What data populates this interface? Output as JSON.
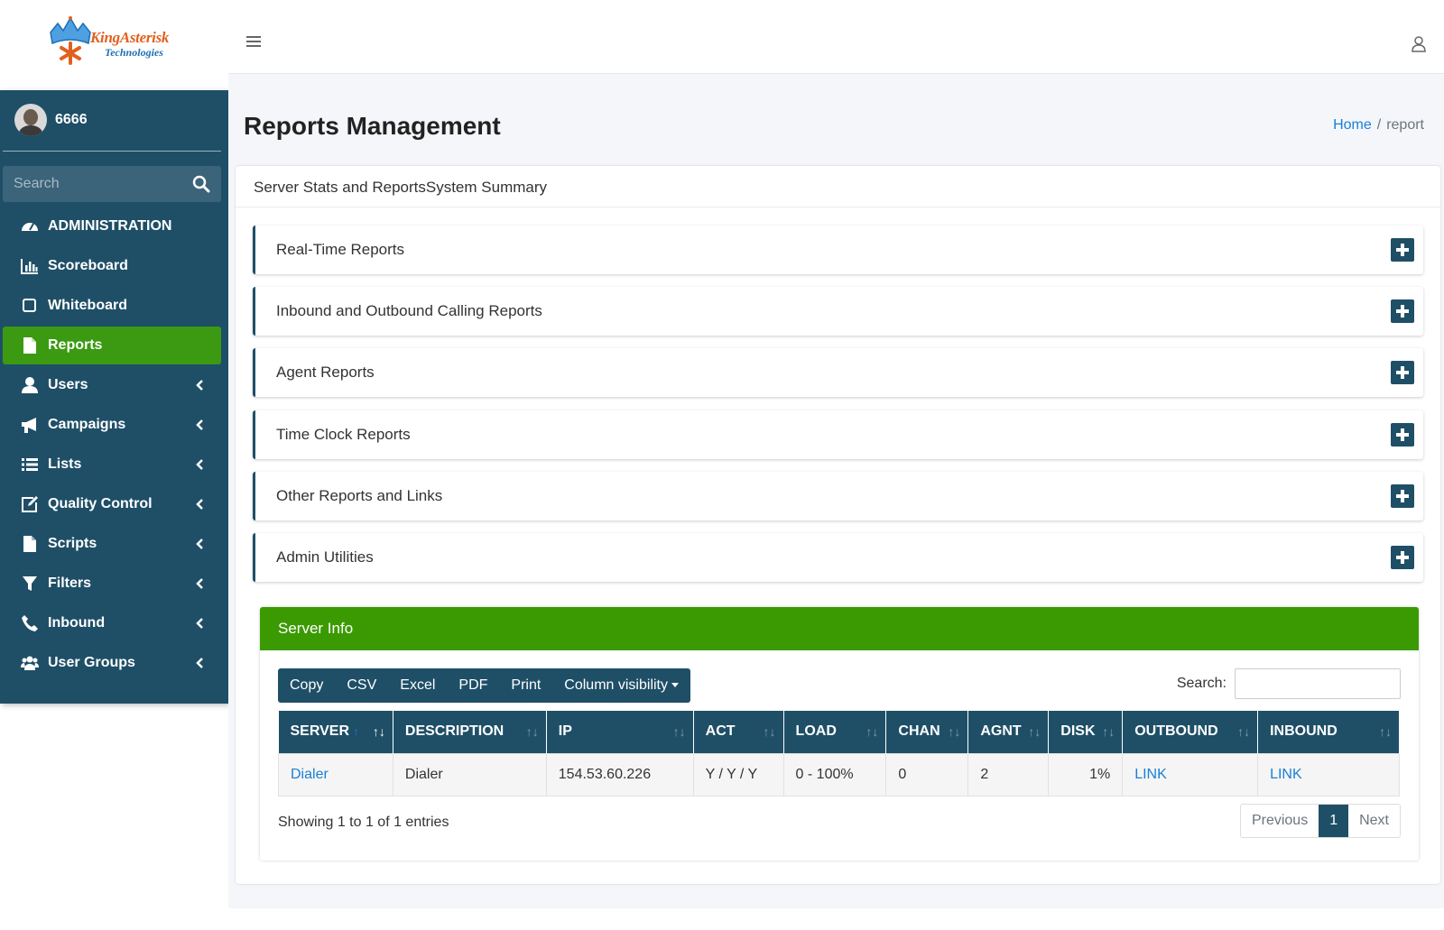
{
  "logo": {
    "brand": "KingAsterisk",
    "sub": "Technologies"
  },
  "user": {
    "name": "6666"
  },
  "sidebar": {
    "search_placeholder": "Search",
    "items": [
      {
        "label": "ADMINISTRATION",
        "icon": "dashboard-icon",
        "active": false,
        "has_chevron": false
      },
      {
        "label": "Scoreboard",
        "icon": "bar-chart-icon",
        "active": false,
        "has_chevron": false
      },
      {
        "label": "Whiteboard",
        "icon": "square-icon",
        "active": false,
        "has_chevron": false
      },
      {
        "label": "Reports",
        "icon": "file-icon",
        "active": true,
        "has_chevron": false
      },
      {
        "label": "Users",
        "icon": "user-icon",
        "active": false,
        "has_chevron": true
      },
      {
        "label": "Campaigns",
        "icon": "bullhorn-icon",
        "active": false,
        "has_chevron": true
      },
      {
        "label": "Lists",
        "icon": "list-icon",
        "active": false,
        "has_chevron": true
      },
      {
        "label": "Quality Control",
        "icon": "edit-icon",
        "active": false,
        "has_chevron": true
      },
      {
        "label": "Scripts",
        "icon": "file-icon",
        "active": false,
        "has_chevron": true
      },
      {
        "label": "Filters",
        "icon": "filter-icon",
        "active": false,
        "has_chevron": true
      },
      {
        "label": "Inbound",
        "icon": "phone-icon",
        "active": false,
        "has_chevron": true
      },
      {
        "label": "User Groups",
        "icon": "users-icon",
        "active": false,
        "has_chevron": true
      }
    ]
  },
  "page": {
    "title": "Reports Management",
    "breadcrumb": {
      "home": "Home",
      "sep": "/",
      "current": "report"
    },
    "card_title": "Server Stats and ReportsSystem Summary"
  },
  "sections": [
    "Real-Time Reports",
    "Inbound and Outbound Calling Reports",
    "Agent Reports",
    "Time Clock Reports",
    "Other Reports and Links",
    "Admin Utilities"
  ],
  "server_info": {
    "title": "Server Info",
    "buttons": [
      "Copy",
      "CSV",
      "Excel",
      "PDF",
      "Print",
      "Column visibility"
    ],
    "search_label": "Search:",
    "columns": [
      "SERVER",
      "DESCRIPTION",
      "IP",
      "ACT",
      "LOAD",
      "CHAN",
      "AGNT",
      "DISK",
      "OUTBOUND",
      "INBOUND"
    ],
    "rows": [
      [
        "Dialer",
        "Dialer",
        "154.53.60.226",
        "Y / Y / Y",
        "0 - 100%",
        "0",
        "2",
        "1%",
        "LINK",
        "LINK"
      ]
    ],
    "info": "Showing 1 to 1 of 1 entries",
    "pager": {
      "previous": "Previous",
      "current": "1",
      "next": "Next"
    }
  },
  "colors": {
    "sidebar": "#1f4f67",
    "active": "#3b9a12",
    "server_header": "#3b9a02",
    "link": "#1a7fd6"
  }
}
